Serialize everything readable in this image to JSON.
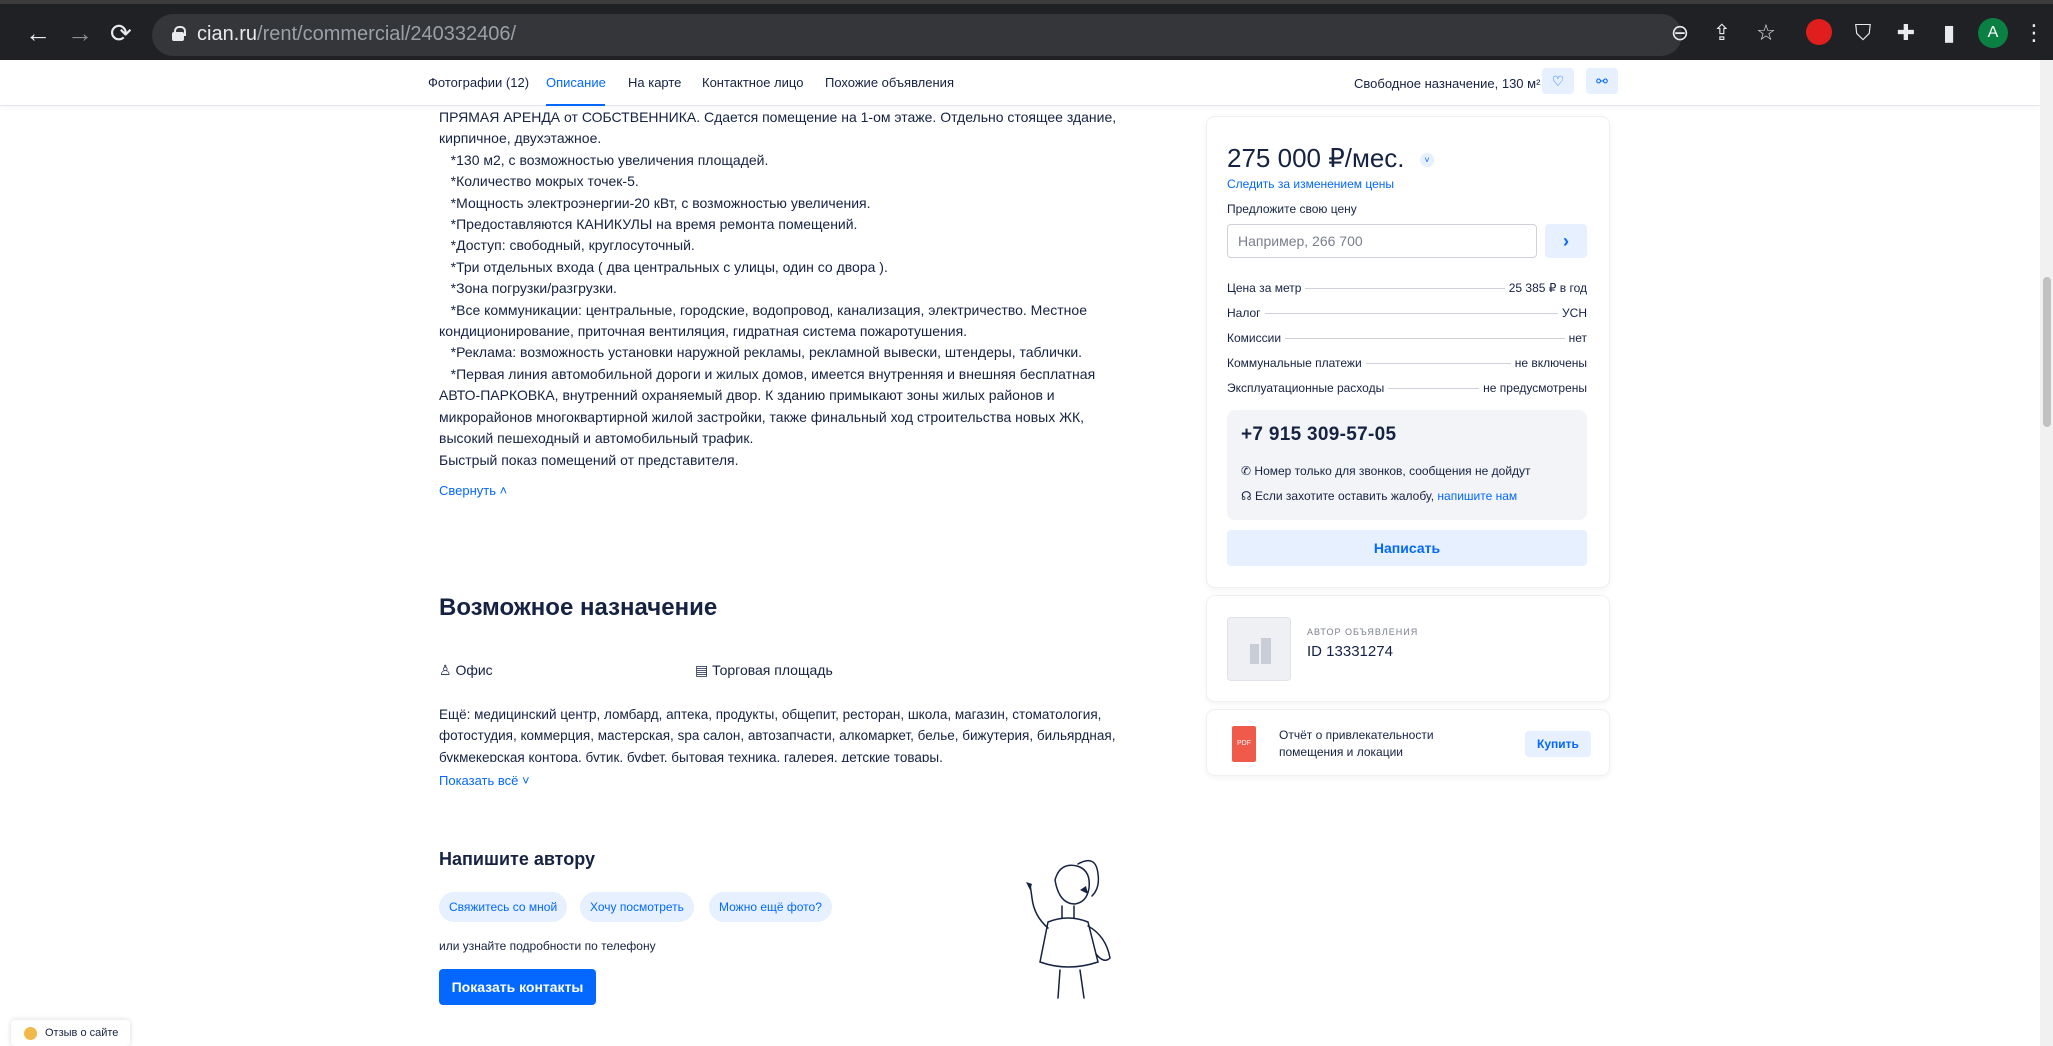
{
  "browser": {
    "url_host": "cian.ru",
    "url_path": "/rent/commercial/240332406/",
    "avatar_letter": "A"
  },
  "tabs": [
    {
      "label": "Фотографии (12)"
    },
    {
      "label": "Описание"
    },
    {
      "label": "На карте"
    },
    {
      "label": "Контактное лицо"
    },
    {
      "label": "Похожие объявления"
    }
  ],
  "tabs_right": {
    "summary": "Свободное назначение, 130 м²"
  },
  "description": {
    "text": "ПРЯМАЯ АРЕНДА от СОБСТВЕННИКА. Сдается помещение на 1-ом этаже. Отдельно стоящее здание,\nкирпичное, двухэтажное.\n   *130 м2, с возможностью увеличения площадей.\n   *Количество мокрых точек-5.\n   *Мощность электроэнергии-20 кВт, с возможностью увеличения.\n   *Предоставляются КАНИКУЛЫ на время ремонта помещений.\n   *Доступ: свободный, круглосуточный.\n   *Три отдельных входа ( два центральных с улицы, один со двора ).\n   *Зона погрузки/разгрузки.\n   *Все коммуникации: центральные, городские, водопровод, канализация, электричество. Местное\nкондиционирование, приточная вентиляция, гидратная система пожаротушения.\n   *Реклама: возможность установки наружной рекламы, рекламной вывески, штендеры, таблички.\n   *Первая линия автомобильной дороги и жилых домов, имеется внутренняя и внешняя бесплатная\nАВТО-ПАРКОВКА, внутренний охраняемый двор. К зданию примыкают зоны жилых районов и\nмикрорайонов многоквартирной жилой застройки, также финальный ход строительства новых ЖК,\nвысокий пешеходный и автомобильный трафик.\nБыстрый показ помещений от представителя.",
    "collapse_label": "Свернуть"
  },
  "purpose": {
    "title": "Возможное назначение",
    "items": [
      {
        "label": "Офис",
        "icon": "office-chair-icon"
      },
      {
        "label": "Торговая площадь",
        "icon": "shop-icon"
      }
    ],
    "more_text": "Ещё: медицинский центр, ломбард, аптека, продукты, общепит, ресторан, школа, магазин, стоматология, фотостудия, коммерция, мастерская, spa салон, автозапчасти, алкомаркет, белье, бижутерия, бильярдная, букмекерская контора, бутик, буфет, бытовая техника, галерея, детские товары,",
    "show_all_label": "Показать всё"
  },
  "write_author": {
    "title": "Напишите автору",
    "chips": [
      "Свяжитесь со мной",
      "Хочу посмотреть",
      "Можно ещё фото?"
    ],
    "phone_hint": "или узнайте подробности по телефону",
    "show_contacts_label": "Показать контакты"
  },
  "sidebar": {
    "price": "275 000 ₽/мес.",
    "track_price_label": "Следить за изменением цены",
    "offer_label": "Предложите свою цену",
    "offer_placeholder": "Например, 266 700",
    "details": [
      {
        "label": "Цена за метр",
        "value": "25 385 ₽ в год"
      },
      {
        "label": "Налог",
        "value": "УСН"
      },
      {
        "label": "Комиссии",
        "value": "нет"
      },
      {
        "label": "Коммунальные платежи",
        "value": "не включены"
      },
      {
        "label": "Эксплуатационные расходы",
        "value": "не предусмотрены"
      }
    ],
    "phone": "+7 915 309-57-05",
    "phone_note": "Номер только для звонков, сообщения не дойдут",
    "complaint_text": "Если захотите оставить жалобу,",
    "complaint_link": "напишите нам",
    "write_label": "Написать",
    "author_label": "АВТОР ОБЪЯВЛЕНИЯ",
    "author_id": "ID 13331274",
    "report_line1": "Отчёт о привлекательности",
    "report_line2": "помещения и локации",
    "buy_label": "Купить"
  },
  "feedback_label": "Отзыв о сайте",
  "colors": {
    "accent": "#0468ff",
    "accent_light": "#e6f0ff",
    "text": "#152242"
  }
}
